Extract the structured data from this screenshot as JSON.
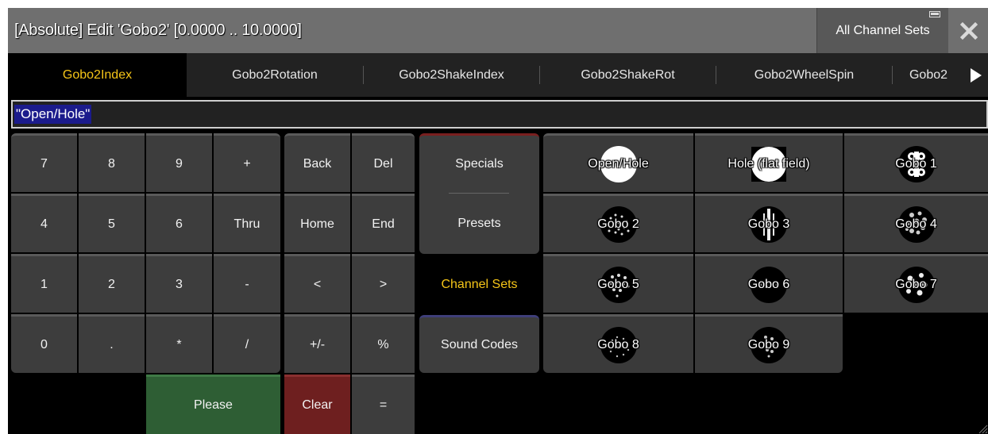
{
  "window": {
    "title": "[Absolute] Edit 'Gobo2' [0.0000 .. 10.0000]",
    "all_channel_sets": "All Channel Sets"
  },
  "tabs": [
    {
      "label": "Gobo2Index",
      "active": true
    },
    {
      "label": "Gobo2Rotation"
    },
    {
      "label": "Gobo2ShakeIndex"
    },
    {
      "label": "Gobo2ShakeRot"
    },
    {
      "label": "Gobo2WheelSpin"
    },
    {
      "label": "Gobo2"
    }
  ],
  "input": {
    "value": "\"Open/Hole\""
  },
  "keypad": {
    "rows": [
      [
        "7",
        "8",
        "9",
        "+"
      ],
      [
        "4",
        "5",
        "6",
        "Thru"
      ],
      [
        "1",
        "2",
        "3",
        "-"
      ],
      [
        "0",
        ".",
        "*",
        "/"
      ]
    ],
    "please": "Please"
  },
  "edit_keys": {
    "rows": [
      [
        "Back",
        "Del"
      ],
      [
        "Home",
        "End"
      ],
      [
        "<",
        ">"
      ],
      [
        "+/-",
        "%"
      ]
    ],
    "clear": "Clear",
    "equals": "="
  },
  "categories": [
    {
      "label": "Specials"
    },
    {
      "label": "Presets"
    },
    {
      "label": "Channel Sets",
      "active": true
    },
    {
      "label": "Sound Codes"
    }
  ],
  "presets": [
    {
      "label": "Open/Hole",
      "icon": "open-hole-icon"
    },
    {
      "label": "Hole (flat field)",
      "icon": "flat-field-icon"
    },
    {
      "label": "Gobo 1",
      "icon": "gobo-1-icon"
    },
    {
      "label": "Gobo 2",
      "icon": "gobo-2-icon"
    },
    {
      "label": "Gobo 3",
      "icon": "gobo-3-icon"
    },
    {
      "label": "Gobo 4",
      "icon": "gobo-4-icon"
    },
    {
      "label": "Gobo 5",
      "icon": "gobo-5-icon"
    },
    {
      "label": "Gobo 6",
      "icon": "gobo-6-icon"
    },
    {
      "label": "Gobo 7",
      "icon": "gobo-7-icon"
    },
    {
      "label": "Gobo 8",
      "icon": "gobo-8-icon"
    },
    {
      "label": "Gobo 9",
      "icon": "gobo-9-icon"
    }
  ],
  "colors": {
    "active_tab_text": "#f5c518",
    "please_button": "#2e5e34",
    "clear_button": "#6e1f1f",
    "input_selection": "#1b1b8c"
  }
}
